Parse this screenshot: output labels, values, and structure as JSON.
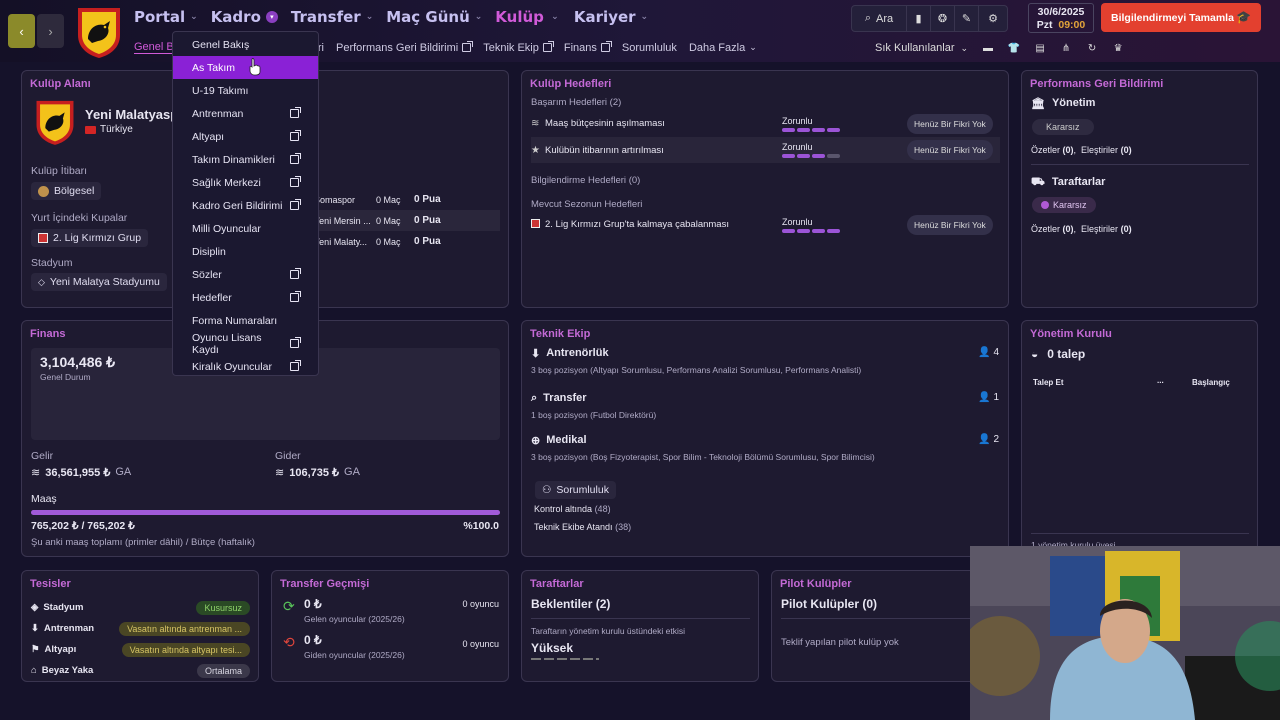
{
  "header": {
    "nav": [
      "Portal",
      "Kadro",
      "Transfer",
      "Maç Günü",
      "Kulüp",
      "Kariyer"
    ],
    "active_nav": "Kulüp",
    "subnav": [
      {
        "label": "Genel Ba",
        "ext": false
      },
      {
        "label": "ri",
        "ext": false
      },
      {
        "label": "Performans Geri Bildirimi",
        "ext": true
      },
      {
        "label": "Teknik Ekip",
        "ext": true
      },
      {
        "label": "Finans",
        "ext": true
      },
      {
        "label": "Sorumluluk",
        "ext": false
      },
      {
        "label": "Daha Fazla",
        "ext": false
      }
    ],
    "search_label": "Ara",
    "date": "30/6/2025",
    "day": "Pzt",
    "time": "09:00",
    "continue_label": "Bilgilendirmeyi Tamamla",
    "quick_label": "Sık Kullanılanlar"
  },
  "dropdown": {
    "items": [
      {
        "label": "Genel Bakış",
        "ext": false,
        "hl": false
      },
      {
        "label": "As Takım",
        "ext": false,
        "hl": true
      },
      {
        "label": "U-19 Takımı",
        "ext": false,
        "hl": false
      },
      {
        "label": "Antrenman",
        "ext": true,
        "hl": false
      },
      {
        "label": "Altyapı",
        "ext": true,
        "hl": false
      },
      {
        "label": "Takım Dinamikleri",
        "ext": true,
        "hl": false
      },
      {
        "label": "Sağlık Merkezi",
        "ext": true,
        "hl": false
      },
      {
        "label": "Kadro Geri Bildirimi",
        "ext": true,
        "hl": false
      },
      {
        "label": "Milli Oyuncular",
        "ext": false,
        "hl": false
      },
      {
        "label": "Disiplin",
        "ext": false,
        "hl": false
      },
      {
        "label": "Sözler",
        "ext": true,
        "hl": false
      },
      {
        "label": "Hedefler",
        "ext": true,
        "hl": false
      },
      {
        "label": "Forma Numaraları",
        "ext": false,
        "hl": false
      },
      {
        "label": "Oyuncu Lisans Kaydı",
        "ext": true,
        "hl": false
      },
      {
        "label": "Kiralık Oyuncular",
        "ext": true,
        "hl": false
      }
    ]
  },
  "club": {
    "title": "Kulüp Alanı",
    "name": "Yeni Malatyasp",
    "country": "Türkiye",
    "rep_label": "Kulüp İtibarı",
    "rep_value": "Bölgesel",
    "cups_label": "Yurt İçindeki Kupalar",
    "cup_value": "2. Lig Kırmızı Grup",
    "stadium_label": "Stadyum",
    "stadium_value": "Yeni Malatya Stadyumu",
    "fixtures": [
      {
        "team": "Somaspor",
        "games": "0 Maç",
        "points": "0 Pua"
      },
      {
        "team": "Yeni Mersin ...",
        "games": "0 Maç",
        "points": "0 Pua"
      },
      {
        "team": "Yeni Malaty...",
        "games": "0 Maç",
        "points": "0 Pua"
      }
    ]
  },
  "goals": {
    "title": "Kulüp Hedefleri",
    "success_header": "Başarım Hedefleri",
    "success_count": "(2)",
    "items1": [
      {
        "text": "Maaş bütçesinin aşılmaması",
        "level": "Zorunlu",
        "filled": 4,
        "btn": "Henüz Bir Fikri Yok"
      },
      {
        "text": "Kulübün itibarının artırılması",
        "level": "Zorunlu",
        "filled": 3,
        "btn": "Henüz Bir Fikri Yok"
      }
    ],
    "info_header": "Bilgilendirme Hedefleri",
    "info_count": "(0)",
    "season_header": "Mevcut Sezonun Hedefleri",
    "items2": [
      {
        "text": "2. Lig Kırmızı Grup'ta kalmaya çabalanması",
        "level": "Zorunlu",
        "filled": 4,
        "btn": "Henüz Bir Fikri Yok"
      }
    ]
  },
  "feedback": {
    "title": "Performans Geri Bildirimi",
    "sections": [
      {
        "name": "Yönetim",
        "badge": "Kararsız",
        "summary": "Özetler",
        "summary_count": "(0)",
        "critic": "Eleştiriler",
        "critic_count": "(0)"
      },
      {
        "name": "Taraftarlar",
        "badge": "Kararsız",
        "summary": "Özetler",
        "summary_count": "(0)",
        "critic": "Eleştiriler",
        "critic_count": "(0)"
      }
    ]
  },
  "finance": {
    "title": "Finans",
    "balance": "3,104,486 ₺",
    "balance_label": "Genel Durum",
    "income_label": "Gelir",
    "income": "36,561,955 ₺",
    "income_suffix": "GA",
    "expense_label": "Gider",
    "expense": "106,735 ₺",
    "expense_suffix": "GA",
    "wage_label": "Maaş",
    "wage_value": "765,202 ₺ / 765,202 ₺",
    "wage_pct": "%100.0",
    "wage_fill": 1.0,
    "wage_note": "Şu anki maaş toplamı (primler dâhil) / Bütçe (haftalık)"
  },
  "staff": {
    "title": "Teknik Ekip",
    "groups": [
      {
        "name": "Antrenörlük",
        "count": "4",
        "desc": "3 boş pozisyon (Altyapı Sorumlusu, Performans Analizi Sorumlusu, Performans Analisti)"
      },
      {
        "name": "Transfer",
        "count": "1",
        "desc": "1 boş pozisyon (Futbol Direktörü)"
      },
      {
        "name": "Medikal",
        "count": "2",
        "desc": "3 boş pozisyon (Boş Fizyoterapist, Spor Bilim - Teknoloji Bölümü Sorumlusu, Spor Bilimcisi)"
      }
    ],
    "resp_label": "Sorumluluk",
    "control_label": "Kontrol altında",
    "control_count": "(48)",
    "assigned_label": "Teknik Ekibe Atandı",
    "assigned_count": "(38)"
  },
  "board": {
    "title": "Yönetim Kurulu",
    "requests": "0 talep",
    "col1": "Talep Et",
    "col2": "...",
    "col3": "Başlangıç",
    "footer": "1 yönetim kurulu üyesi"
  },
  "facilities": {
    "title": "Tesisler",
    "rows": [
      {
        "name": "Stadyum",
        "value": "Kusursuz",
        "bg": "#2a4a25",
        "fg": "#8fd36a"
      },
      {
        "name": "Antrenman",
        "value": "Vasatın altında antrenman ...",
        "bg": "#4a4624",
        "fg": "#d6c464"
      },
      {
        "name": "Altyapı",
        "value": "Vasatın altında altyapı tesi...",
        "bg": "#4a4624",
        "fg": "#d6c464"
      },
      {
        "name": "Beyaz Yaka",
        "value": "Ortalama",
        "bg": "#3b384a",
        "fg": "#d8d6e2"
      }
    ]
  },
  "transfers": {
    "title": "Transfer Geçmişi",
    "in_value": "0 ₺",
    "in_label": "Gelen oyuncular (2025/26)",
    "in_count": "0 oyuncu",
    "out_value": "0 ₺",
    "out_label": "Giden oyuncular (2025/26)",
    "out_count": "0 oyuncu"
  },
  "fans": {
    "title": "Taraftarlar",
    "expect": "Beklentiler (2)",
    "influence_label": "Taraftarın yönetim kurulu üstündeki etkisi",
    "influence": "Yüksek"
  },
  "pilot": {
    "title": "Pilot Kulüpler",
    "heading": "Pilot Kulüpler (0)",
    "empty": "Teklif yapılan pilot kulüp yok"
  },
  "colors": {
    "accent": "#8a21d6",
    "title": "#c46ad6",
    "continue": "#e3402f"
  }
}
